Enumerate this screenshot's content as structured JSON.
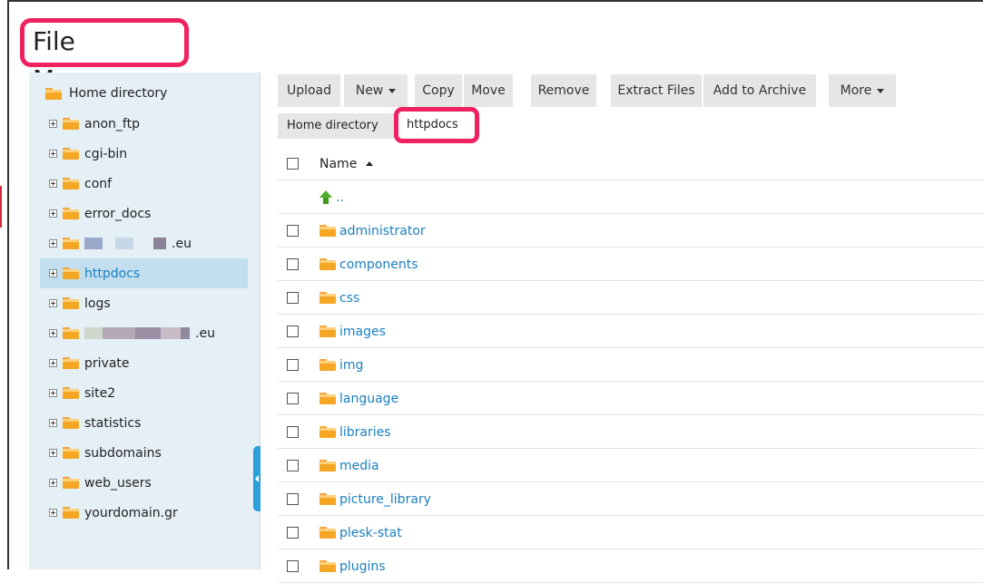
{
  "title": "File Manager",
  "colors": {
    "accent": "#1a7fc0",
    "highlight": "#f0215f",
    "sidebar": "#e5eff6",
    "folder": "#f5a623"
  },
  "sidebar": {
    "root_label": "Home directory",
    "items": [
      {
        "label": "anon_ftp"
      },
      {
        "label": "cgi-bin"
      },
      {
        "label": "conf"
      },
      {
        "label": "error_docs"
      },
      {
        "label": ".eu",
        "obscured": true
      },
      {
        "label": "httpdocs",
        "selected": true
      },
      {
        "label": "logs"
      },
      {
        "label": ".eu",
        "obscured": true
      },
      {
        "label": "private"
      },
      {
        "label": "site2"
      },
      {
        "label": "statistics"
      },
      {
        "label": "subdomains"
      },
      {
        "label": "web_users"
      },
      {
        "label": "yourdomain.gr"
      }
    ]
  },
  "toolbar": {
    "upload": "Upload",
    "new": "New",
    "copy": "Copy",
    "move": "Move",
    "remove": "Remove",
    "extract": "Extract Files",
    "archive": "Add to Archive",
    "more": "More"
  },
  "breadcrumb": {
    "home": "Home directory",
    "current": "httpdocs"
  },
  "table": {
    "header_name": "Name",
    "parent_label": "..",
    "rows": [
      "administrator",
      "components",
      "css",
      "images",
      "img",
      "language",
      "libraries",
      "media",
      "picture_library",
      "plesk-stat",
      "plugins"
    ]
  }
}
